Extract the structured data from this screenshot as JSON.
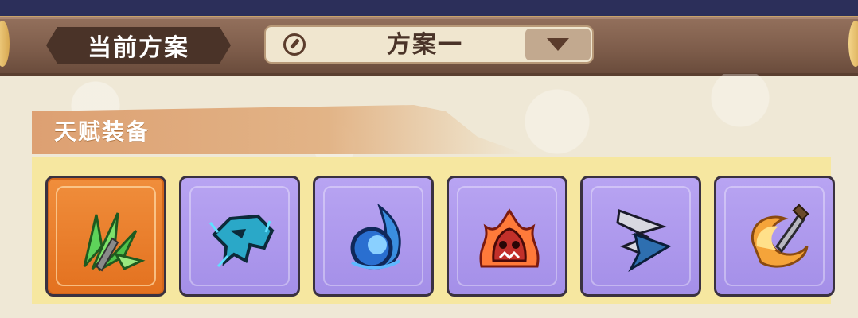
{
  "header": {
    "section_label": "当前方案",
    "plan_selector": {
      "value": "方案一"
    }
  },
  "talent": {
    "title": "天赋装备",
    "slots": [
      {
        "icon": "green-shards-icon",
        "selected": true
      },
      {
        "icon": "blue-beast-icon",
        "selected": false
      },
      {
        "icon": "blue-orb-icon",
        "selected": false
      },
      {
        "icon": "red-skull-flame-icon",
        "selected": false
      },
      {
        "icon": "zigzag-lightning-icon",
        "selected": false
      },
      {
        "icon": "flaming-sword-icon",
        "selected": false
      }
    ]
  },
  "colors": {
    "header_bar": "#7d5c4a",
    "slot_active": "#e3711f",
    "slot_normal": "#a48fe8",
    "strip": "#f6e7a0"
  }
}
